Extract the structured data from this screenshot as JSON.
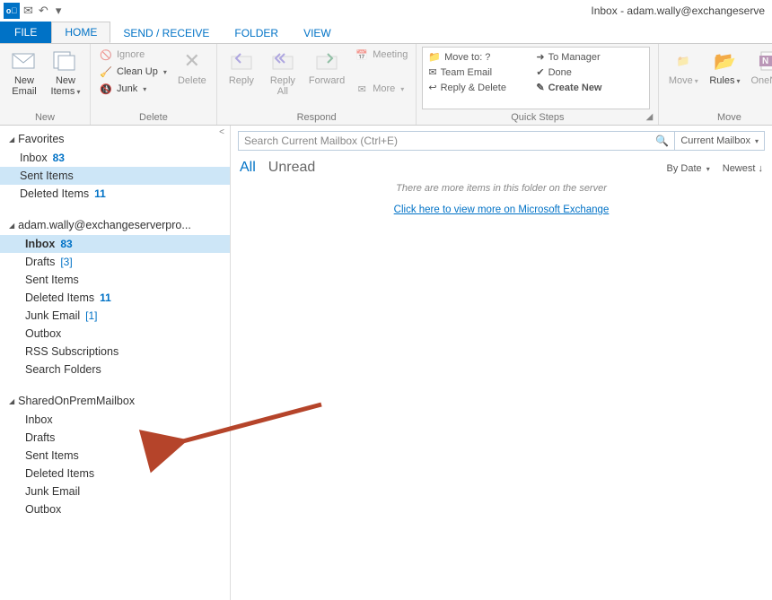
{
  "window": {
    "title": "Inbox - adam.wally@exchangeserve"
  },
  "ribbon_tabs": {
    "file": "FILE",
    "home": "HOME",
    "sendreceive": "SEND / RECEIVE",
    "folder": "FOLDER",
    "view": "VIEW"
  },
  "ribbon": {
    "groups": {
      "new": "New",
      "delete": "Delete",
      "respond": "Respond",
      "quicksteps": "Quick Steps",
      "move": "Move"
    },
    "new_email": "New\nEmail",
    "new_items": "New\nItems",
    "ignore": "Ignore",
    "cleanup": "Clean Up",
    "junk": "Junk",
    "delete": "Delete",
    "reply": "Reply",
    "replyall": "Reply\nAll",
    "forward": "Forward",
    "meeting": "Meeting",
    "more": "More",
    "qs": {
      "moveto": "Move to: ?",
      "team": "Team Email",
      "replydel": "Reply & Delete",
      "tomgr": "To Manager",
      "done": "Done",
      "create": "Create New"
    },
    "move": "Move",
    "rules": "Rules",
    "onenote": "OneNote"
  },
  "sidebar": {
    "favorites": {
      "header": "Favorites",
      "inbox": "Inbox",
      "inbox_count": "83",
      "sent": "Sent Items",
      "deleted": "Deleted Items",
      "deleted_count": "11"
    },
    "account1": {
      "header": "adam.wally@exchangeserverpro...",
      "inbox": "Inbox",
      "inbox_count": "83",
      "drafts": "Drafts",
      "drafts_count": "[3]",
      "sent": "Sent Items",
      "deleted": "Deleted Items",
      "deleted_count": "11",
      "junk": "Junk Email",
      "junk_count": "[1]",
      "outbox": "Outbox",
      "rss": "RSS Subscriptions",
      "search": "Search Folders"
    },
    "account2": {
      "header": "SharedOnPremMailbox",
      "inbox": "Inbox",
      "drafts": "Drafts",
      "sent": "Sent Items",
      "deleted": "Deleted Items",
      "junk": "Junk Email",
      "outbox": "Outbox"
    }
  },
  "main": {
    "search_ph": "Search Current Mailbox (Ctrl+E)",
    "scope": "Current Mailbox",
    "filter_all": "All",
    "filter_unread": "Unread",
    "sort_by": "By Date",
    "sort_order": "Newest",
    "info": "There are more items in this folder on the server",
    "link": "Click here to view more on Microsoft Exchange"
  }
}
